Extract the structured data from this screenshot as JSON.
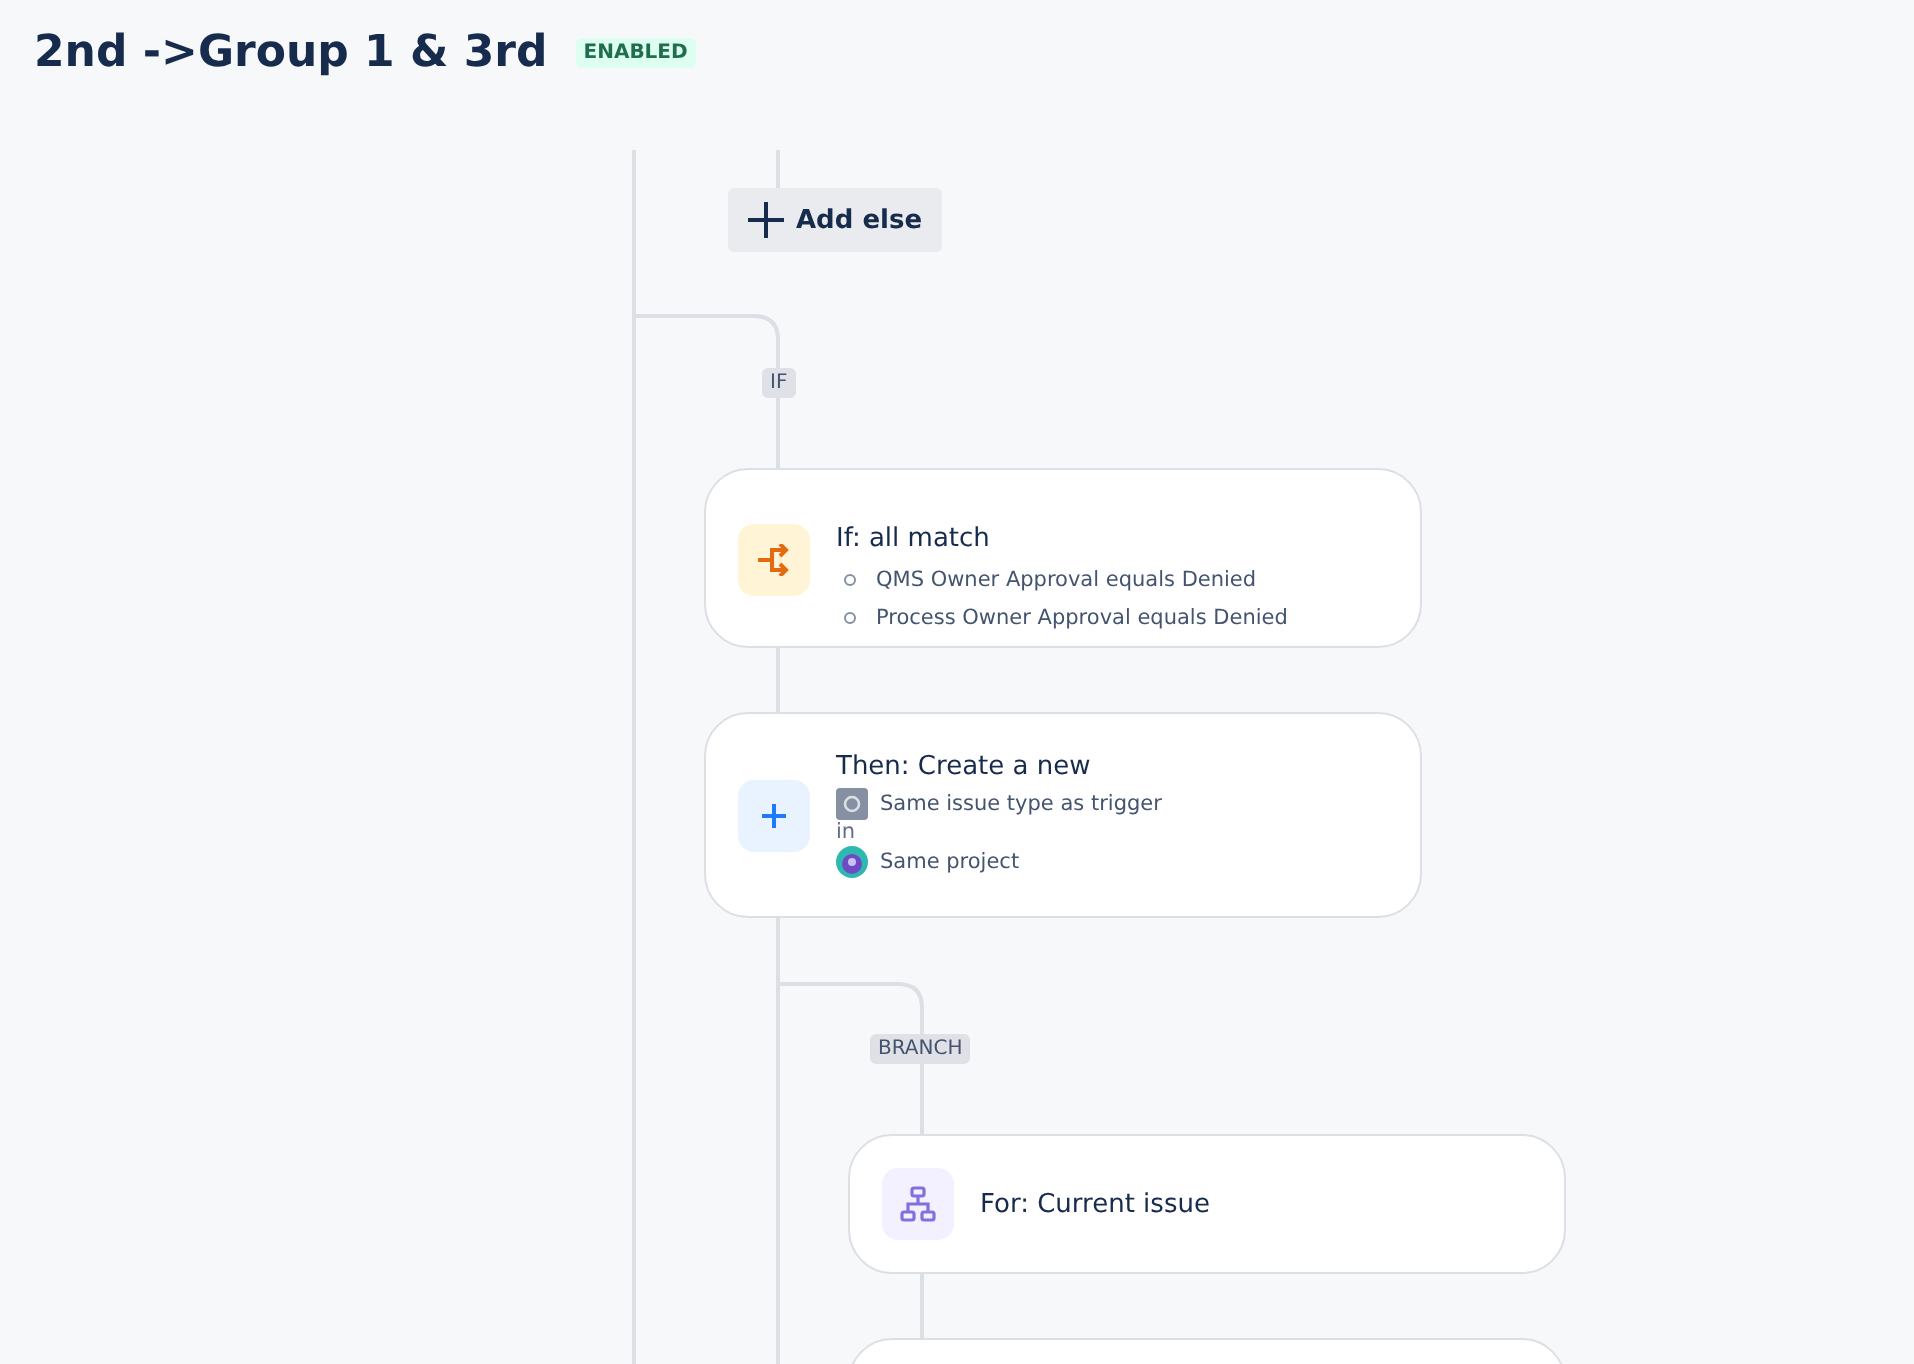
{
  "header": {
    "title": "2nd ->Group 1 & 3rd",
    "status": "ENABLED"
  },
  "add_else": {
    "label": "Add else"
  },
  "if_label": "IF",
  "branch_label": "BRANCH",
  "nodes": [
    {
      "kind": "condition",
      "title": "If: all match",
      "conditions": [
        "QMS Owner Approval equals Denied",
        "Process Owner Approval equals Denied"
      ]
    },
    {
      "kind": "action",
      "title": "Then: Create a new",
      "issue_type": "Same issue type as trigger",
      "joiner": "in",
      "project": "Same project"
    },
    {
      "kind": "branch",
      "title": "For: Current issue"
    },
    {
      "kind": "empty"
    }
  ]
}
